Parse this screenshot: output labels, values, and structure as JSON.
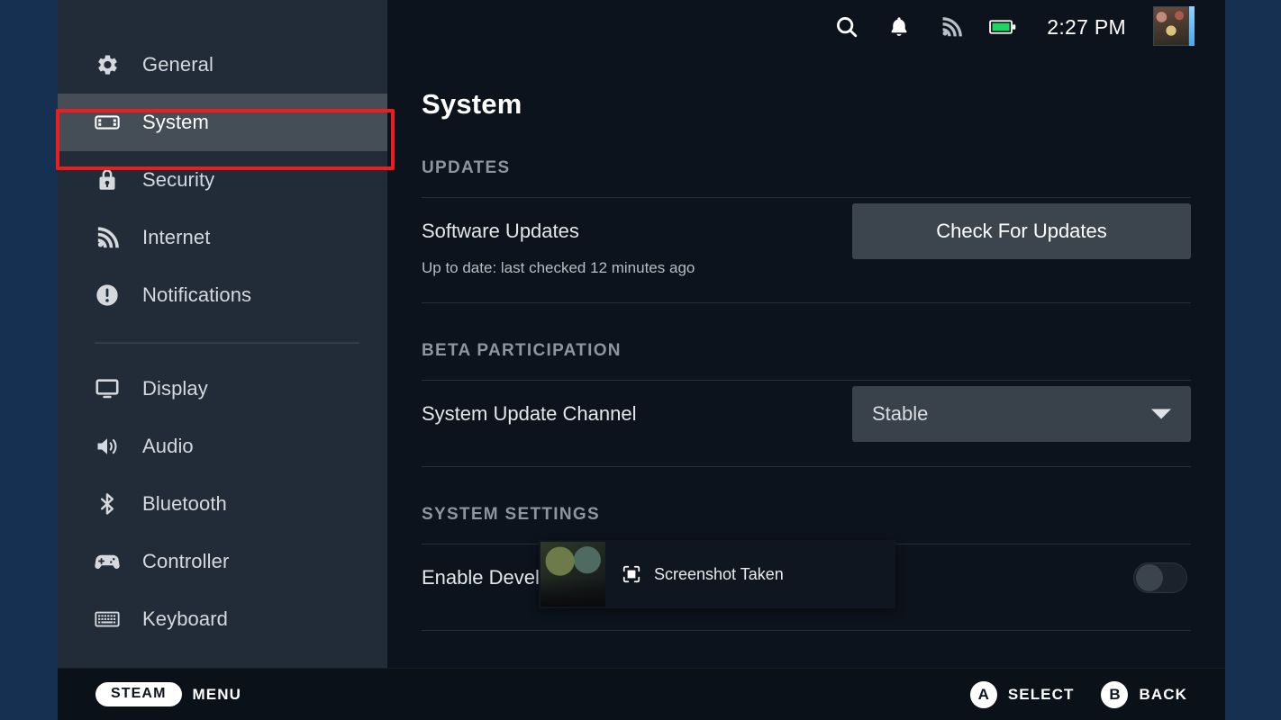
{
  "statusbar": {
    "icons": [
      "search-icon",
      "bell-icon",
      "wifi-icon",
      "battery-icon"
    ],
    "time": "2:27 PM",
    "battery_color": "#1ed760"
  },
  "sidebar": {
    "items": [
      {
        "label": "General",
        "icon": "gear-icon",
        "selected": false
      },
      {
        "label": "System",
        "icon": "steamdeck-icon",
        "selected": true
      },
      {
        "label": "Security",
        "icon": "lock-icon",
        "selected": false
      },
      {
        "label": "Internet",
        "icon": "wifi-icon",
        "selected": false
      },
      {
        "label": "Notifications",
        "icon": "exclamation-icon",
        "selected": false
      },
      {
        "label": "Display",
        "icon": "monitor-icon",
        "selected": false
      },
      {
        "label": "Audio",
        "icon": "speaker-icon",
        "selected": false
      },
      {
        "label": "Bluetooth",
        "icon": "bluetooth-icon",
        "selected": false
      },
      {
        "label": "Controller",
        "icon": "gamepad-icon",
        "selected": false
      },
      {
        "label": "Keyboard",
        "icon": "keyboard-icon",
        "selected": false
      }
    ],
    "highlight_color": "#ee1c1c"
  },
  "main": {
    "title": "System",
    "sections": [
      {
        "heading": "UPDATES",
        "row_label": "Software Updates",
        "button_label": "Check For Updates",
        "sub_text": "Up to date: last checked 12 minutes ago"
      },
      {
        "heading": "BETA PARTICIPATION",
        "row_label": "System Update Channel",
        "dropdown_value": "Stable"
      },
      {
        "heading": "SYSTEM SETTINGS",
        "row_label": "Enable Developer Mode",
        "toggle_state": "off"
      }
    ]
  },
  "toast": {
    "icon": "screenshot-icon",
    "text": "Screenshot Taken"
  },
  "bottombar": {
    "steam_pill": "STEAM",
    "menu_label": "MENU",
    "a_button": "A",
    "select_label": "SELECT",
    "b_button": "B",
    "back_label": "BACK"
  }
}
